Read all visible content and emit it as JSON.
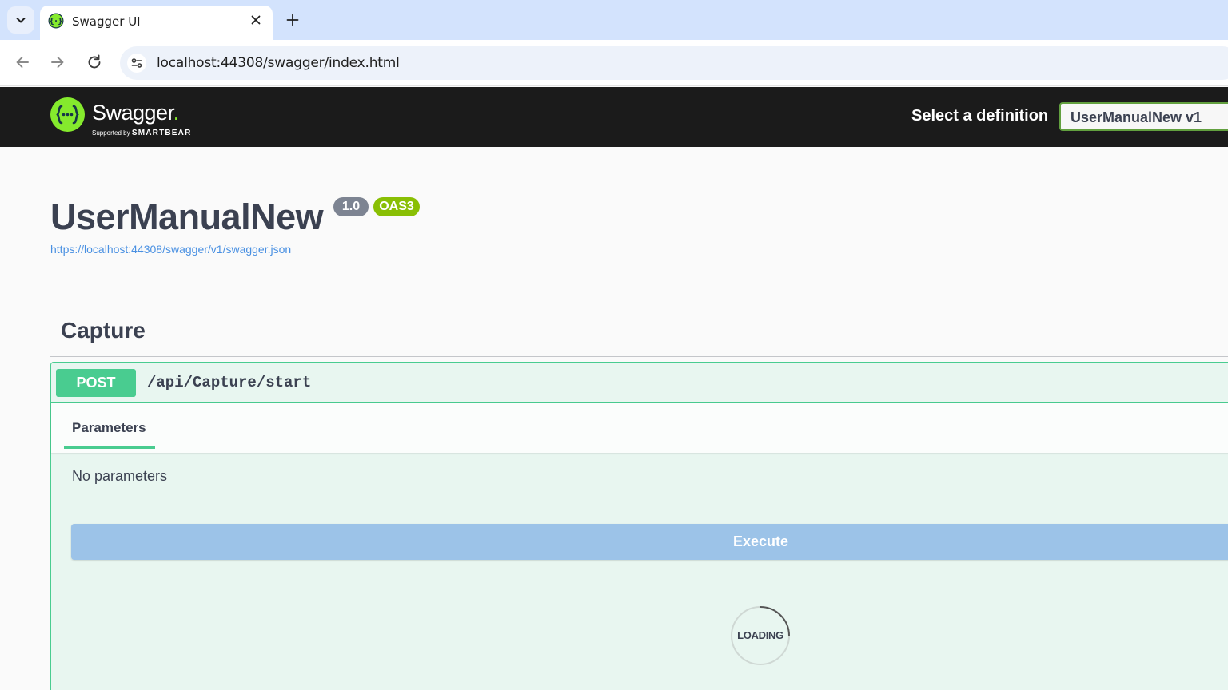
{
  "browser": {
    "tab_title": "Swagger UI",
    "url": "localhost:44308/swagger/index.html"
  },
  "topbar": {
    "brand": "Swagger",
    "brand_dot": ".",
    "supported_prefix": "Supported by",
    "supported_brand": "SMARTBEAR",
    "select_label": "Select a definition",
    "selected_definition": "UserManualNew v1"
  },
  "info": {
    "title": "UserManualNew",
    "version_badge": "1.0",
    "oas_badge": "OAS3",
    "spec_url": "https://localhost:44308/swagger/v1/swagger.json"
  },
  "tag": {
    "name": "Capture"
  },
  "operation": {
    "method": "POST",
    "path": "/api/Capture/start",
    "params_tab": "Parameters",
    "no_params": "No parameters",
    "execute_label": "Execute",
    "loading_text": "LOADING"
  },
  "colors": {
    "post_green": "#49cc90",
    "topbar_bg": "#1b1b1b",
    "execute_blue": "#9cc3e8",
    "badge_grey": "#7d8492",
    "oas_green": "#89bf04",
    "link_blue": "#4990e2"
  },
  "icons": {
    "tab_menu": "chevron-down-icon",
    "favicon": "swagger-favicon-icon",
    "tab_close": "close-icon",
    "new_tab": "plus-icon",
    "back": "arrow-left-icon",
    "forward": "arrow-right-icon",
    "reload": "reload-icon",
    "site_info": "tune-icon",
    "logo": "swagger-logo-icon"
  }
}
